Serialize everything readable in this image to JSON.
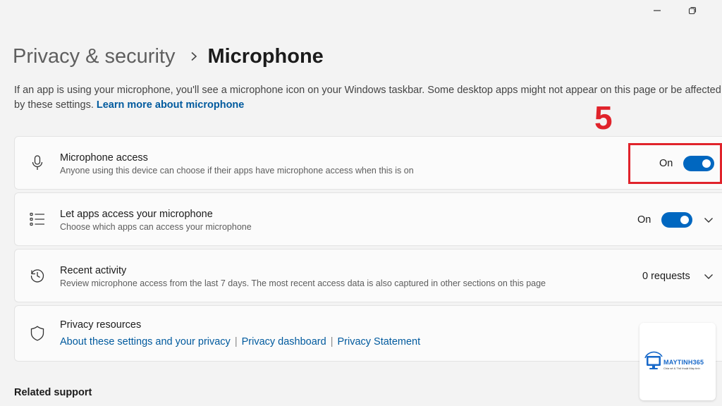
{
  "window": {
    "minimize_icon": "minimize-icon",
    "restore_icon": "restore-icon"
  },
  "breadcrumb": {
    "parent": "Privacy & security",
    "current": "Microphone"
  },
  "intro": {
    "text": "If an app is using your microphone, you'll see a microphone icon on your Windows taskbar. Some desktop apps might not appear on this page or be affected by these settings.",
    "link": "Learn more about microphone"
  },
  "annotation": {
    "step": "5",
    "color": "#e0232b"
  },
  "settings": {
    "microphone_access": {
      "icon": "microphone-icon",
      "title": "Microphone access",
      "description": "Anyone using this device can choose if their apps have microphone access when this is on",
      "state": "On",
      "toggle_on": true
    },
    "let_apps": {
      "icon": "app-list-icon",
      "title": "Let apps access your microphone",
      "description": "Choose which apps can access your microphone",
      "state": "On",
      "toggle_on": true
    },
    "recent_activity": {
      "icon": "history-icon",
      "title": "Recent activity",
      "description": "Review microphone access from the last 7 days. The most recent access data is also captured in other sections on this page",
      "value": "0 requests"
    },
    "privacy_resources": {
      "icon": "shield-icon",
      "title": "Privacy resources",
      "links": [
        "About these settings and your privacy",
        "Privacy dashboard",
        "Privacy Statement"
      ]
    }
  },
  "related_support": "Related support",
  "watermark": {
    "name": "MAYTINH365",
    "tagline": "Chia sẻ & Thủ thuật Máy tính"
  },
  "colors": {
    "accent": "#0067c0",
    "link": "#005a9e",
    "background": "#f3f3f3",
    "card": "#fbfbfb"
  }
}
